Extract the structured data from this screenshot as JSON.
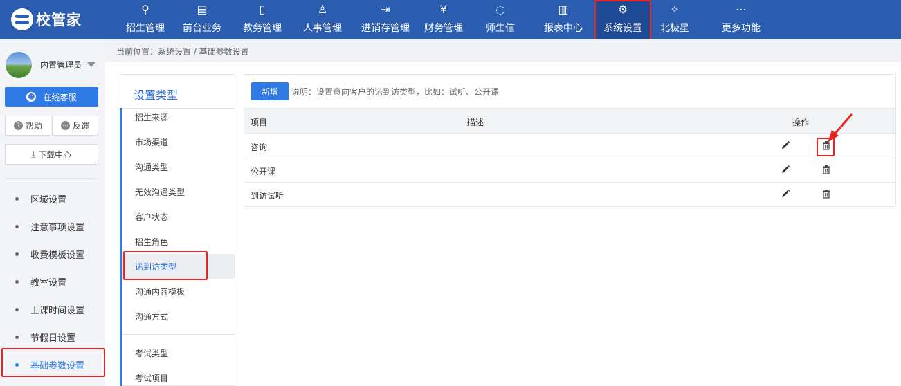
{
  "app": {
    "logo_text": "校管家"
  },
  "top_nav": [
    {
      "label": "招生管理",
      "icon": "user-plus-icon"
    },
    {
      "label": "前台业务",
      "icon": "front-desk-icon"
    },
    {
      "label": "教务管理",
      "icon": "book-icon"
    },
    {
      "label": "人事管理",
      "icon": "person-icon"
    },
    {
      "label": "进销存管理",
      "icon": "inventory-icon"
    },
    {
      "label": "财务管理",
      "icon": "yuan-icon"
    },
    {
      "label": "师生信",
      "icon": "chat-icon"
    },
    {
      "label": "报表中心",
      "icon": "report-icon"
    },
    {
      "label": "系统设置",
      "icon": "settings-icon",
      "active": true
    },
    {
      "label": "北极星",
      "icon": "star-icon"
    },
    {
      "label": "更多功能",
      "icon": "more-icon"
    }
  ],
  "nav_glyphs": [
    "⚲",
    "▤",
    "▯",
    "♙",
    "⇥",
    "¥",
    "◌",
    "▥",
    "⚙",
    "✧",
    "⋯"
  ],
  "user": {
    "name": "内置管理员"
  },
  "sidebar": {
    "service_label": "在线客服",
    "help_label": "帮助",
    "feedback_label": "反馈",
    "download_label": "下载中心",
    "items": [
      {
        "label": "区域设置"
      },
      {
        "label": "注意事项设置"
      },
      {
        "label": "收费模板设置"
      },
      {
        "label": "教室设置"
      },
      {
        "label": "上课时间设置"
      },
      {
        "label": "节假日设置"
      },
      {
        "label": "基础参数设置",
        "active": true
      }
    ]
  },
  "breadcrumb": {
    "text": "当前位置：系统设置 / 基础参数设置"
  },
  "settings_type": {
    "title": "设置类型",
    "items": [
      {
        "label": "招生来源"
      },
      {
        "label": "市场渠道"
      },
      {
        "label": "沟通类型"
      },
      {
        "label": "无效沟通类型"
      },
      {
        "label": "客户状态"
      },
      {
        "label": "招生角色"
      },
      {
        "label": "诺到访类型",
        "active": true
      },
      {
        "label": "沟通内容模板"
      },
      {
        "label": "沟通方式"
      }
    ],
    "items2": [
      {
        "label": "考试类型"
      },
      {
        "label": "考试项目"
      }
    ]
  },
  "main": {
    "add_label": "新增",
    "description": "说明：设置意向客户的诺到访类型，比如：试听、公开课",
    "columns": {
      "item": "项目",
      "desc": "描述",
      "ops": "操作"
    },
    "rows": [
      {
        "item": "咨询",
        "desc": ""
      },
      {
        "item": "公开课",
        "desc": ""
      },
      {
        "item": "到访试听",
        "desc": ""
      }
    ]
  },
  "colors": {
    "topbar": "#2a5db0",
    "accent": "#2f7ae5",
    "highlight": "#e8261f"
  }
}
